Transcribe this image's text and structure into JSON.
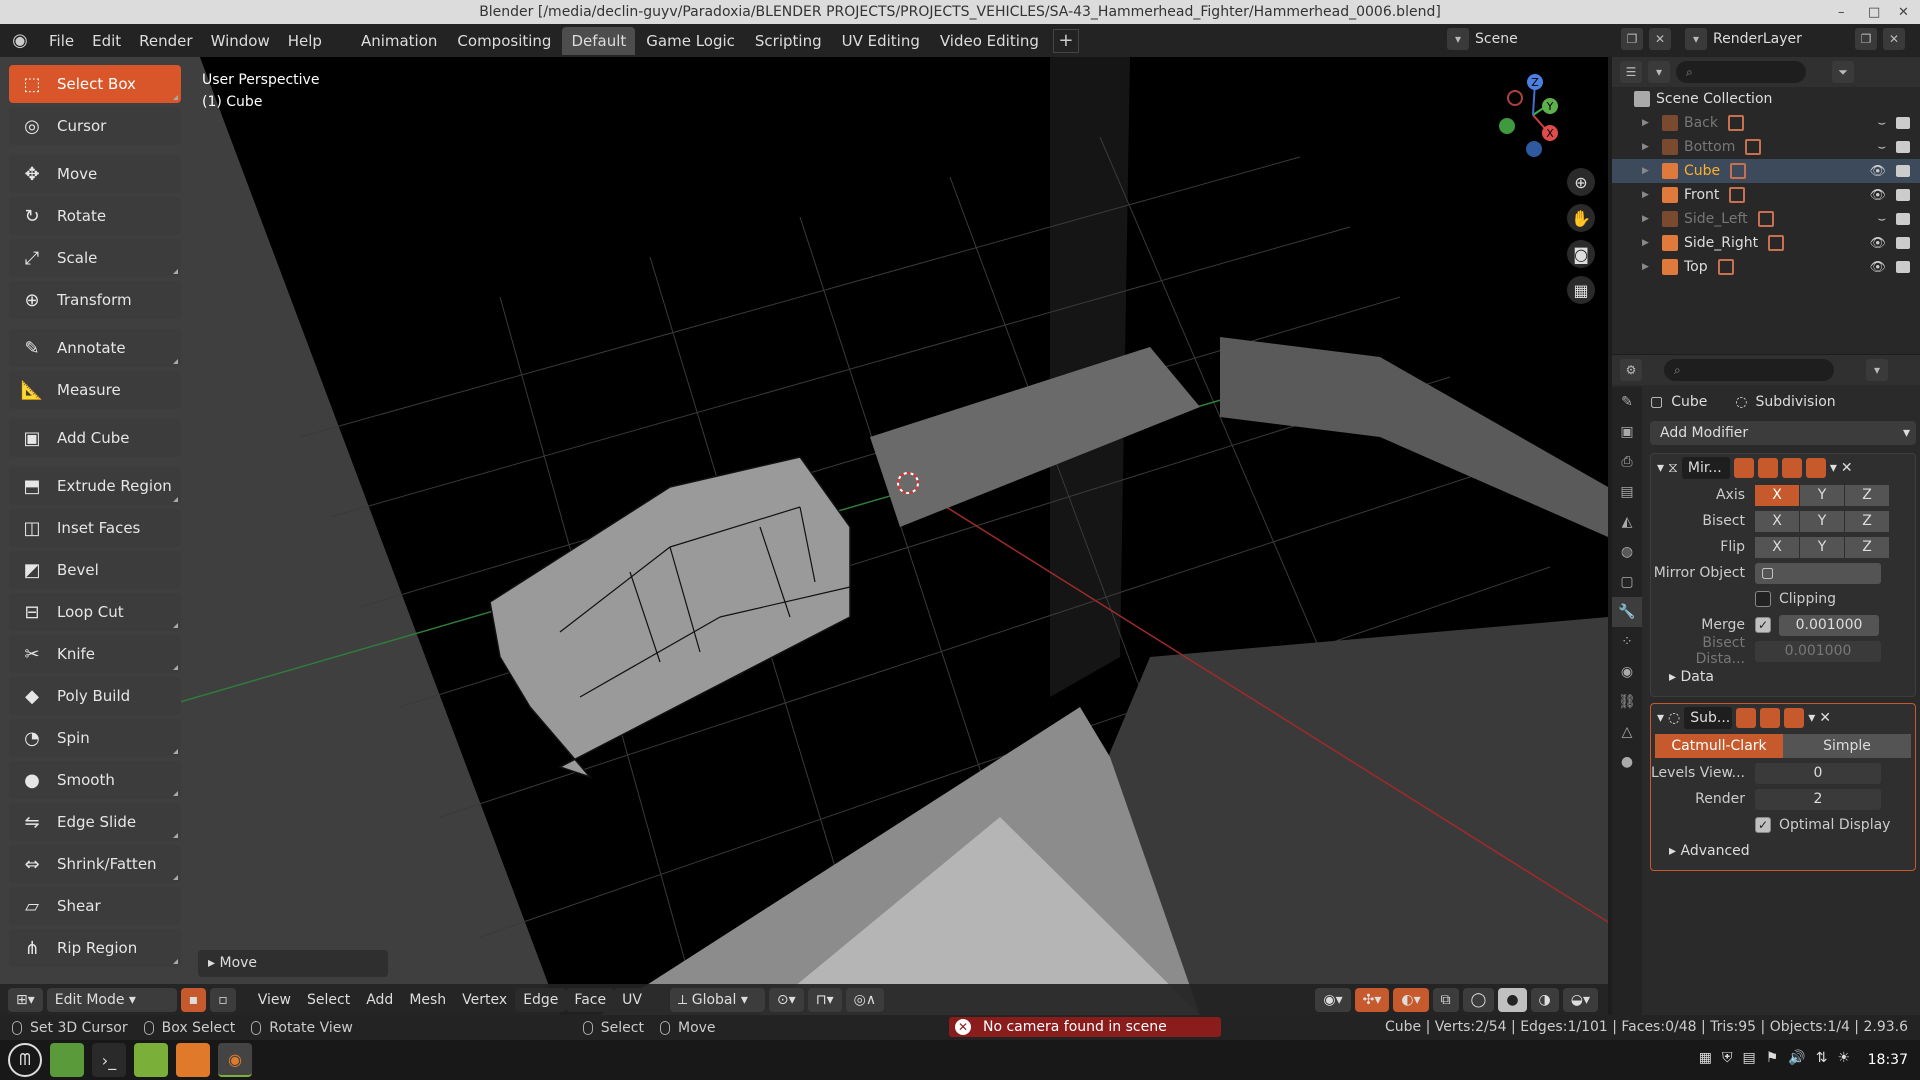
{
  "window": {
    "title": "Blender [/media/declin-guyv/Paradoxia/BLENDER PROJECTS/PROJECTS_VEHICLES/SA-43_Hammerhead_Fighter/Hammerhead_0006.blend]",
    "minimize": "–",
    "close": "✕"
  },
  "menu": {
    "items": [
      "File",
      "Edit",
      "Render",
      "Window",
      "Help"
    ]
  },
  "workspaces": {
    "tabs": [
      "Animation",
      "Compositing",
      "Default",
      "Game Logic",
      "Scripting",
      "UV Editing",
      "Video Editing"
    ],
    "active": "Default",
    "add": "+"
  },
  "scene": {
    "name": "Scene",
    "render_layer": "RenderLayer"
  },
  "tools": [
    {
      "label": "Select Box",
      "icon": "select-box-icon",
      "active": true,
      "tri": true
    },
    {
      "label": "Cursor",
      "icon": "cursor-icon"
    },
    {
      "gap": true,
      "label": "Move",
      "icon": "move-icon"
    },
    {
      "label": "Rotate",
      "icon": "rotate-icon"
    },
    {
      "label": "Scale",
      "icon": "scale-icon",
      "tri": true
    },
    {
      "label": "Transform",
      "icon": "transform-icon"
    },
    {
      "gap": true,
      "label": "Annotate",
      "icon": "annotate-icon",
      "tri": true
    },
    {
      "label": "Measure",
      "icon": "measure-icon"
    },
    {
      "gap": true,
      "label": "Add Cube",
      "icon": "add-cube-icon"
    },
    {
      "gap": true,
      "label": "Extrude Region",
      "icon": "extrude-icon",
      "tri": true
    },
    {
      "label": "Inset Faces",
      "icon": "inset-icon"
    },
    {
      "label": "Bevel",
      "icon": "bevel-icon"
    },
    {
      "label": "Loop Cut",
      "icon": "loop-cut-icon",
      "tri": true
    },
    {
      "label": "Knife",
      "icon": "knife-icon",
      "tri": true
    },
    {
      "label": "Poly Build",
      "icon": "poly-build-icon"
    },
    {
      "label": "Spin",
      "icon": "spin-icon",
      "tri": true
    },
    {
      "label": "Smooth",
      "icon": "smooth-icon",
      "tri": true
    },
    {
      "label": "Edge Slide",
      "icon": "edge-slide-icon",
      "tri": true
    },
    {
      "label": "Shrink/Fatten",
      "icon": "shrink-icon",
      "tri": true
    },
    {
      "label": "Shear",
      "icon": "shear-icon"
    },
    {
      "label": "Rip Region",
      "icon": "rip-icon",
      "tri": true
    }
  ],
  "viewport": {
    "view_name": "User Perspective",
    "object": "(1) Cube",
    "last_op": "Move",
    "gizmo": {
      "x": "X",
      "y": "Y",
      "z": "Z"
    }
  },
  "vpheader": {
    "mode": "Edit Mode",
    "menus": [
      "View",
      "Select",
      "Add",
      "Mesh",
      "Vertex",
      "Edge",
      "Face",
      "UV"
    ],
    "orientation": "Global"
  },
  "status": {
    "left": [
      {
        "icon": "mouse-left",
        "label": "Set 3D Cursor"
      },
      {
        "icon": "mouse-left",
        "label": "Box Select"
      },
      {
        "icon": "mouse-mid",
        "label": "Rotate View"
      },
      {
        "icon": "mouse-left",
        "label": "Select"
      },
      {
        "icon": "mouse-left",
        "label": "Move"
      }
    ],
    "error": "No camera found in scene \"Scene\"",
    "stats": "Cube | Verts:2/54 | Edges:1/101 | Faces:0/48 | Tris:95 | Objects:1/4 | 2.93.6"
  },
  "taskbar": {
    "clock": "18:37"
  },
  "outliner": {
    "root": "Scene Collection",
    "items": [
      {
        "name": "Back",
        "dim": true
      },
      {
        "name": "Bottom",
        "dim": true
      },
      {
        "name": "Cube",
        "selected": true,
        "mesh": true
      },
      {
        "name": "Front"
      },
      {
        "name": "Side_Left",
        "dim": true
      },
      {
        "name": "Side_Right"
      },
      {
        "name": "Top"
      }
    ]
  },
  "properties": {
    "object": "Cube",
    "modifier_ctx": "Subdivision",
    "add_modifier": "Add Modifier",
    "mirror": {
      "name": "Mir...",
      "axis_label": "Axis",
      "bisect_label": "Bisect",
      "flip_label": "Flip",
      "xyz": [
        "X",
        "Y",
        "Z"
      ],
      "mirror_object": "Mirror Object",
      "clipping": "Clipping",
      "merge_label": "Merge",
      "merge_value": "0.001000",
      "bisect_dist_label": "Bisect Dista...",
      "bisect_dist_value": "0.001000",
      "data": "Data"
    },
    "subsurf": {
      "name": "Sub...",
      "catmull": "Catmull-Clark",
      "simple": "Simple",
      "levels_label": "Levels View...",
      "levels_value": "0",
      "render_label": "Render",
      "render_value": "2",
      "optimal": "Optimal Display",
      "advanced": "Advanced"
    }
  }
}
